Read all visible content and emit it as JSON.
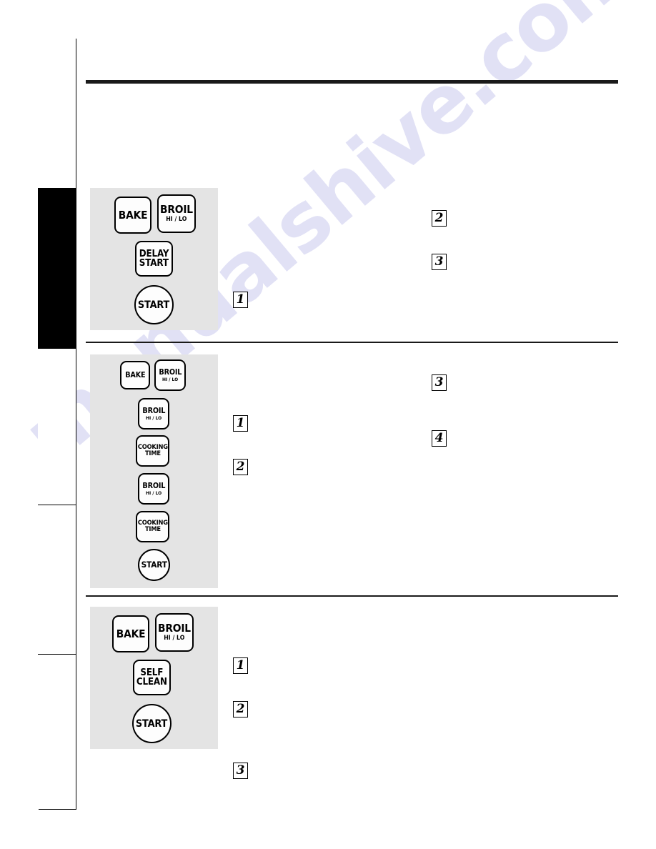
{
  "document": {
    "type": "appliance-manual-page",
    "watermark_text": "manualshive.com",
    "page_background": "#ffffff",
    "accent_dark": "#000000",
    "panel_gray": "#e4e4e4",
    "watermark_color": "#cfcff0"
  },
  "sidebar": {
    "name": "section-tab-strip",
    "segments": [
      {
        "index": 0,
        "label": "",
        "active": false
      },
      {
        "index": 1,
        "label": "",
        "active": true
      },
      {
        "index": 2,
        "label": "",
        "active": false
      },
      {
        "index": 3,
        "label": "",
        "active": false
      },
      {
        "index": 4,
        "label": "",
        "active": false
      }
    ]
  },
  "rules": {
    "top_rule": "thick",
    "section_rule_1": "thin",
    "section_rule_2": "thin"
  },
  "sections": [
    {
      "id": "section-delay-start",
      "panel": {
        "name": "oven-control-panel-1",
        "buttons": [
          {
            "name": "bake-button",
            "main": "BAKE",
            "sub": "",
            "shape": "rect",
            "size": "lg"
          },
          {
            "name": "broil-hi-lo-button",
            "main": "BROIL",
            "sub": "HI / LO",
            "shape": "rect",
            "size": "lg"
          },
          {
            "name": "delay-start-button",
            "main": "DELAY\nSTART",
            "sub": "",
            "shape": "rect",
            "size": "md"
          },
          {
            "name": "start-button",
            "main": "START",
            "sub": "",
            "shape": "circle",
            "size": "lg"
          }
        ]
      },
      "steps": [
        {
          "label": "1",
          "column": "left"
        },
        {
          "label": "2",
          "column": "right"
        },
        {
          "label": "3",
          "column": "right"
        }
      ]
    },
    {
      "id": "section-timed-broil",
      "panel": {
        "name": "oven-control-panel-2",
        "buttons": [
          {
            "name": "bake-button",
            "main": "BAKE",
            "sub": "",
            "shape": "rect",
            "size": "sm"
          },
          {
            "name": "broil-hi-lo-button",
            "main": "BROIL",
            "sub": "HI / LO",
            "shape": "rect",
            "size": "sm"
          },
          {
            "name": "broil-hi-lo-button",
            "main": "BROIL",
            "sub": "HI / LO",
            "shape": "rect",
            "size": "sm"
          },
          {
            "name": "cooking-time-button",
            "main": "COOKING\nTIME",
            "sub": "",
            "shape": "rect",
            "size": "xs"
          },
          {
            "name": "broil-hi-lo-button",
            "main": "BROIL",
            "sub": "HI / LO",
            "shape": "rect",
            "size": "sm"
          },
          {
            "name": "cooking-time-button",
            "main": "COOKING\nTIME",
            "sub": "",
            "shape": "rect",
            "size": "xs"
          },
          {
            "name": "start-button",
            "main": "START",
            "sub": "",
            "shape": "circle",
            "size": "md"
          }
        ]
      },
      "steps": [
        {
          "label": "1",
          "column": "left"
        },
        {
          "label": "2",
          "column": "left"
        },
        {
          "label": "3",
          "column": "right"
        },
        {
          "label": "4",
          "column": "right"
        }
      ]
    },
    {
      "id": "section-self-clean",
      "panel": {
        "name": "oven-control-panel-3",
        "buttons": [
          {
            "name": "bake-button",
            "main": "BAKE",
            "sub": "",
            "shape": "rect",
            "size": "lg"
          },
          {
            "name": "broil-hi-lo-button",
            "main": "BROIL",
            "sub": "HI / LO",
            "shape": "rect",
            "size": "lg"
          },
          {
            "name": "self-clean-button",
            "main": "SELF\nCLEAN",
            "sub": "",
            "shape": "rect",
            "size": "md"
          },
          {
            "name": "start-button",
            "main": "START",
            "sub": "",
            "shape": "circle",
            "size": "lg"
          }
        ]
      },
      "steps": [
        {
          "label": "1",
          "column": "left"
        },
        {
          "label": "2",
          "column": "left"
        },
        {
          "label": "3",
          "column": "left"
        }
      ]
    }
  ],
  "step_markers": {
    "s1_step1": "1",
    "s1_step2": "2",
    "s1_step3": "3",
    "s2_step1": "1",
    "s2_step2": "2",
    "s2_step3": "3",
    "s2_step4": "4",
    "s3_step1": "1",
    "s3_step2": "2",
    "s3_step3": "3"
  },
  "button_labels": {
    "bake": "BAKE",
    "broil": "BROIL",
    "hi_lo": "HI / LO",
    "delay": "DELAY",
    "start_word": "START",
    "cooking": "COOKING",
    "time": "TIME",
    "self": "SELF",
    "clean": "CLEAN",
    "start": "START"
  }
}
